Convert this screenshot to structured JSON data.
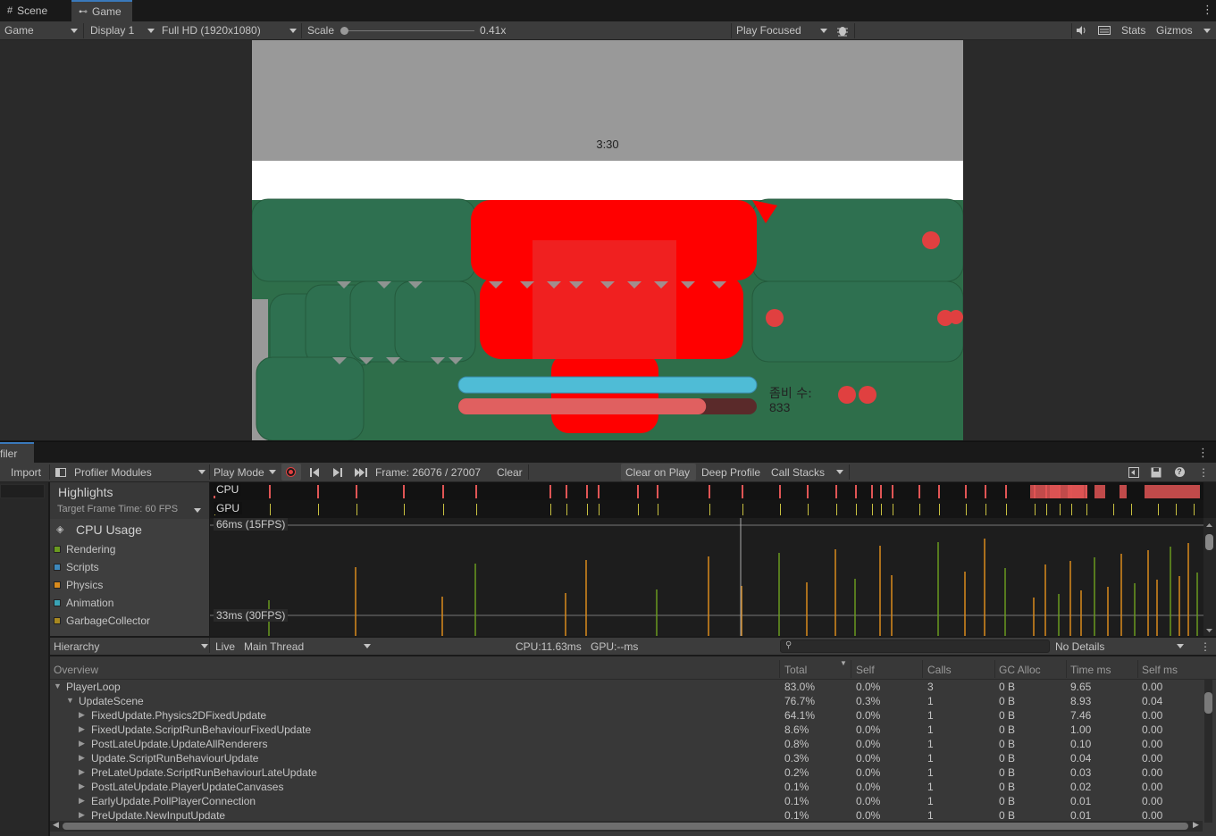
{
  "tabs": [
    {
      "label": "Scene",
      "icon": "grid-icon"
    },
    {
      "label": "Game",
      "icon": "gamepad-icon"
    }
  ],
  "game_toolbar": {
    "mode": "Game",
    "display": "Display 1",
    "resolution": "Full HD (1920x1080)",
    "scale_label": "Scale",
    "scale_value": "0.41x",
    "scale_fraction": 0.0,
    "play_mode": "Play Focused",
    "stats": "Stats",
    "gizmos": "Gizmos"
  },
  "game_view": {
    "timer": "3:30",
    "zombie_label": "좀비 수:",
    "zombie_count": "833",
    "health_bar_fraction": 1.0,
    "exp_bar_fraction": 0.83,
    "colors": {
      "sky": "#999999",
      "ground": "#2e6e4a",
      "enemy": "#ff0000",
      "health": "#4fbcd6",
      "exp": "#e06060"
    }
  },
  "profiler": {
    "window_title": "filer",
    "import": "Import",
    "modules": "Profiler Modules",
    "play_mode": "Play Mode",
    "frame": "Frame: 26076 / 27007",
    "clear": "Clear",
    "clear_on_play": "Clear on Play",
    "deep_profile": "Deep Profile",
    "call_stacks": "Call Stacks",
    "highlights": "Highlights",
    "target_frame": "Target Frame Time: 60 FPS",
    "cpu_lane": "CPU",
    "gpu_lane": "GPU",
    "cpu_usage": "CPU Usage",
    "legend": [
      {
        "label": "Rendering",
        "color": "#6a9a1f"
      },
      {
        "label": "Scripts",
        "color": "#3d88bc"
      },
      {
        "label": "Physics",
        "color": "#d98b1d"
      },
      {
        "label": "Animation",
        "color": "#3aa3b5"
      },
      {
        "label": "GarbageCollector",
        "color": "#a78820"
      }
    ],
    "line_66": "66ms (15FPS)",
    "line_33": "33ms (30FPS)",
    "view": "Hierarchy",
    "live": "Live",
    "thread": "Main Thread",
    "cpu_time": "CPU:11.63ms",
    "gpu_time": "GPU:--ms",
    "details": "No Details",
    "columns": [
      "Overview",
      "Total",
      "Self",
      "Calls",
      "GC Alloc",
      "Time ms",
      "Self ms"
    ],
    "rows": [
      {
        "name": "PlayerLoop",
        "total": "83.0%",
        "self": "0.0%",
        "calls": "3",
        "gc": "0 B",
        "time": "9.65",
        "selfms": "0.00"
      },
      {
        "name": "UpdateScene",
        "total": "76.7%",
        "self": "0.3%",
        "calls": "1",
        "gc": "0 B",
        "time": "8.93",
        "selfms": "0.04"
      },
      {
        "name": "FixedUpdate.Physics2DFixedUpdate",
        "total": "64.1%",
        "self": "0.0%",
        "calls": "1",
        "gc": "0 B",
        "time": "7.46",
        "selfms": "0.00"
      },
      {
        "name": "FixedUpdate.ScriptRunBehaviourFixedUpdate",
        "total": "8.6%",
        "self": "0.0%",
        "calls": "1",
        "gc": "0 B",
        "time": "1.00",
        "selfms": "0.00"
      },
      {
        "name": "PostLateUpdate.UpdateAllRenderers",
        "total": "0.8%",
        "self": "0.0%",
        "calls": "1",
        "gc": "0 B",
        "time": "0.10",
        "selfms": "0.00"
      },
      {
        "name": "Update.ScriptRunBehaviourUpdate",
        "total": "0.3%",
        "self": "0.0%",
        "calls": "1",
        "gc": "0 B",
        "time": "0.04",
        "selfms": "0.00"
      },
      {
        "name": "PreLateUpdate.ScriptRunBehaviourLateUpdate",
        "total": "0.2%",
        "self": "0.0%",
        "calls": "1",
        "gc": "0 B",
        "time": "0.03",
        "selfms": "0.00"
      },
      {
        "name": "PostLateUpdate.PlayerUpdateCanvases",
        "total": "0.1%",
        "self": "0.0%",
        "calls": "1",
        "gc": "0 B",
        "time": "0.02",
        "selfms": "0.00"
      },
      {
        "name": "EarlyUpdate.PollPlayerConnection",
        "total": "0.1%",
        "self": "0.0%",
        "calls": "1",
        "gc": "0 B",
        "time": "0.01",
        "selfms": "0.00"
      },
      {
        "name": "PreUpdate.NewInputUpdate",
        "total": "0.1%",
        "self": "0.0%",
        "calls": "1",
        "gc": "0 B",
        "time": "0.01",
        "selfms": "0.00"
      }
    ]
  }
}
